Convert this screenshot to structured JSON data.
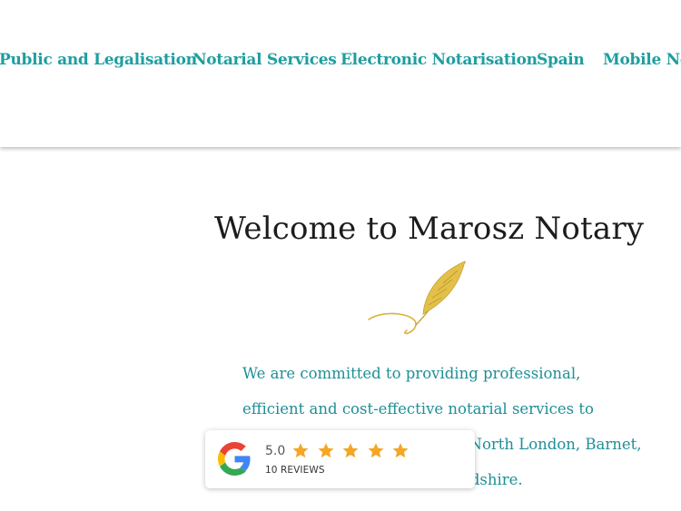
{
  "nav": {
    "items": [
      {
        "label": "Public and Legalisation"
      },
      {
        "label": "Notarial Services"
      },
      {
        "label": "Electronic Notarisation"
      },
      {
        "label": "Spain"
      },
      {
        "label": "Mobile Notary"
      }
    ]
  },
  "main": {
    "title": "Welcome to Marosz Notary",
    "intro": "We are committed to providing professional, efficient and cost-effective notarial services to individuals and businesses in North London, Barnet, Luton and all areas of Hertfordshire."
  },
  "reviews": {
    "rating": "5.0",
    "count_label": "10 REVIEWS",
    "star_color": "#f5a623",
    "icon": "google-g-icon"
  },
  "colors": {
    "accent": "#1f9ea0",
    "text": "#1c1c1c",
    "quill_gold": "#d9b23a"
  }
}
